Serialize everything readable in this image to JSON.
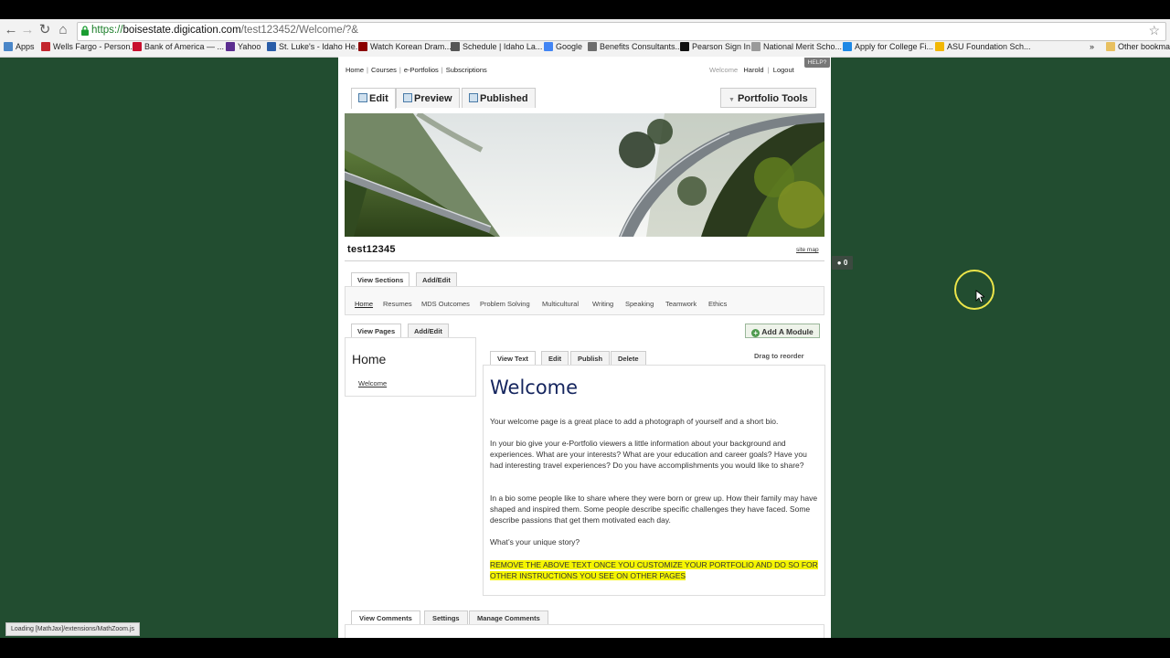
{
  "browser": {
    "url_scheme": "https://",
    "url_host": "boisestate.digication.com",
    "url_path": "/test123452/Welcome/?&",
    "bookmarks": [
      {
        "label": "Apps",
        "color": "#4a86c8"
      },
      {
        "label": "Wells Fargo - Person...",
        "color": "#c3262e"
      },
      {
        "label": "Bank of America — ...",
        "color": "#c8102e"
      },
      {
        "label": "Yahoo",
        "color": "#5b2d90"
      },
      {
        "label": "St. Luke's - Idaho He...",
        "color": "#2a5da8"
      },
      {
        "label": "Watch Korean Dram...",
        "color": "#8b0000"
      },
      {
        "label": "Schedule | Idaho La...",
        "color": "#555555"
      },
      {
        "label": "Google",
        "color": "#4285f4"
      },
      {
        "label": "Benefits Consultants...",
        "color": "#6d6d6d"
      },
      {
        "label": "Pearson Sign In",
        "color": "#111111"
      },
      {
        "label": "National Merit Scho...",
        "color": "#9a9a9a"
      },
      {
        "label": "Apply for College Fi...",
        "color": "#1e88e5"
      },
      {
        "label": "ASU Foundation Sch...",
        "color": "#f2b705"
      }
    ],
    "more_label": "»",
    "other_bookmarks": "Other bookmarks",
    "status": "Loading [MathJax]/extensions/MathZoom.js"
  },
  "header": {
    "nav": [
      "Home",
      "Courses",
      "e-Portfolios",
      "Subscriptions"
    ],
    "welcome_prefix": "Welcome",
    "user": "Harold",
    "logout": "Logout",
    "help": "HELP?"
  },
  "portfolio_tabs": {
    "edit": "Edit",
    "preview": "Preview",
    "published": "Published",
    "tools": "Portfolio Tools"
  },
  "site": {
    "title": "test12345",
    "sitemap": "site map",
    "comment_count": "0"
  },
  "sections": {
    "tab_view": "View Sections",
    "tab_add": "Add/Edit",
    "items": [
      "Home",
      "Resumes",
      "MDS Outcomes",
      "Problem Solving",
      "Multicultural",
      "Writing",
      "Speaking",
      "Teamwork",
      "Ethics"
    ]
  },
  "pages": {
    "tab_view": "View Pages",
    "tab_add": "Add/Edit",
    "add_module": "Add A Module",
    "heading": "Home",
    "link": "Welcome"
  },
  "module": {
    "tabs": [
      "View Text",
      "Edit",
      "Publish",
      "Delete"
    ],
    "drag": "Drag to reorder",
    "title": "Welcome",
    "p1": "Your welcome page is a great place to add a photograph of yourself and a short bio.",
    "p2": "In your bio give your e-Portfolio viewers a little information about your background and experiences. What are your interests? What are your education and career goals? Have you had interesting travel experiences? Do you have accomplishments you would like to share?",
    "p3": "In a bio some people like to share where they were born or grew up. How their family may have shaped and inspired them. Some people describe specific challenges they have faced. Some describe passions that get them motivated each day.",
    "p4": "What’s your unique story?",
    "p5": "REMOVE THE ABOVE TEXT ONCE YOU CUSTOMIZE YOUR PORTFOLIO AND DO SO FOR OTHER INSTRUCTIONS YOU SEE ON OTHER PAGES"
  },
  "comments": {
    "tabs": [
      "View Comments",
      "Settings",
      "Manage Comments"
    ]
  }
}
